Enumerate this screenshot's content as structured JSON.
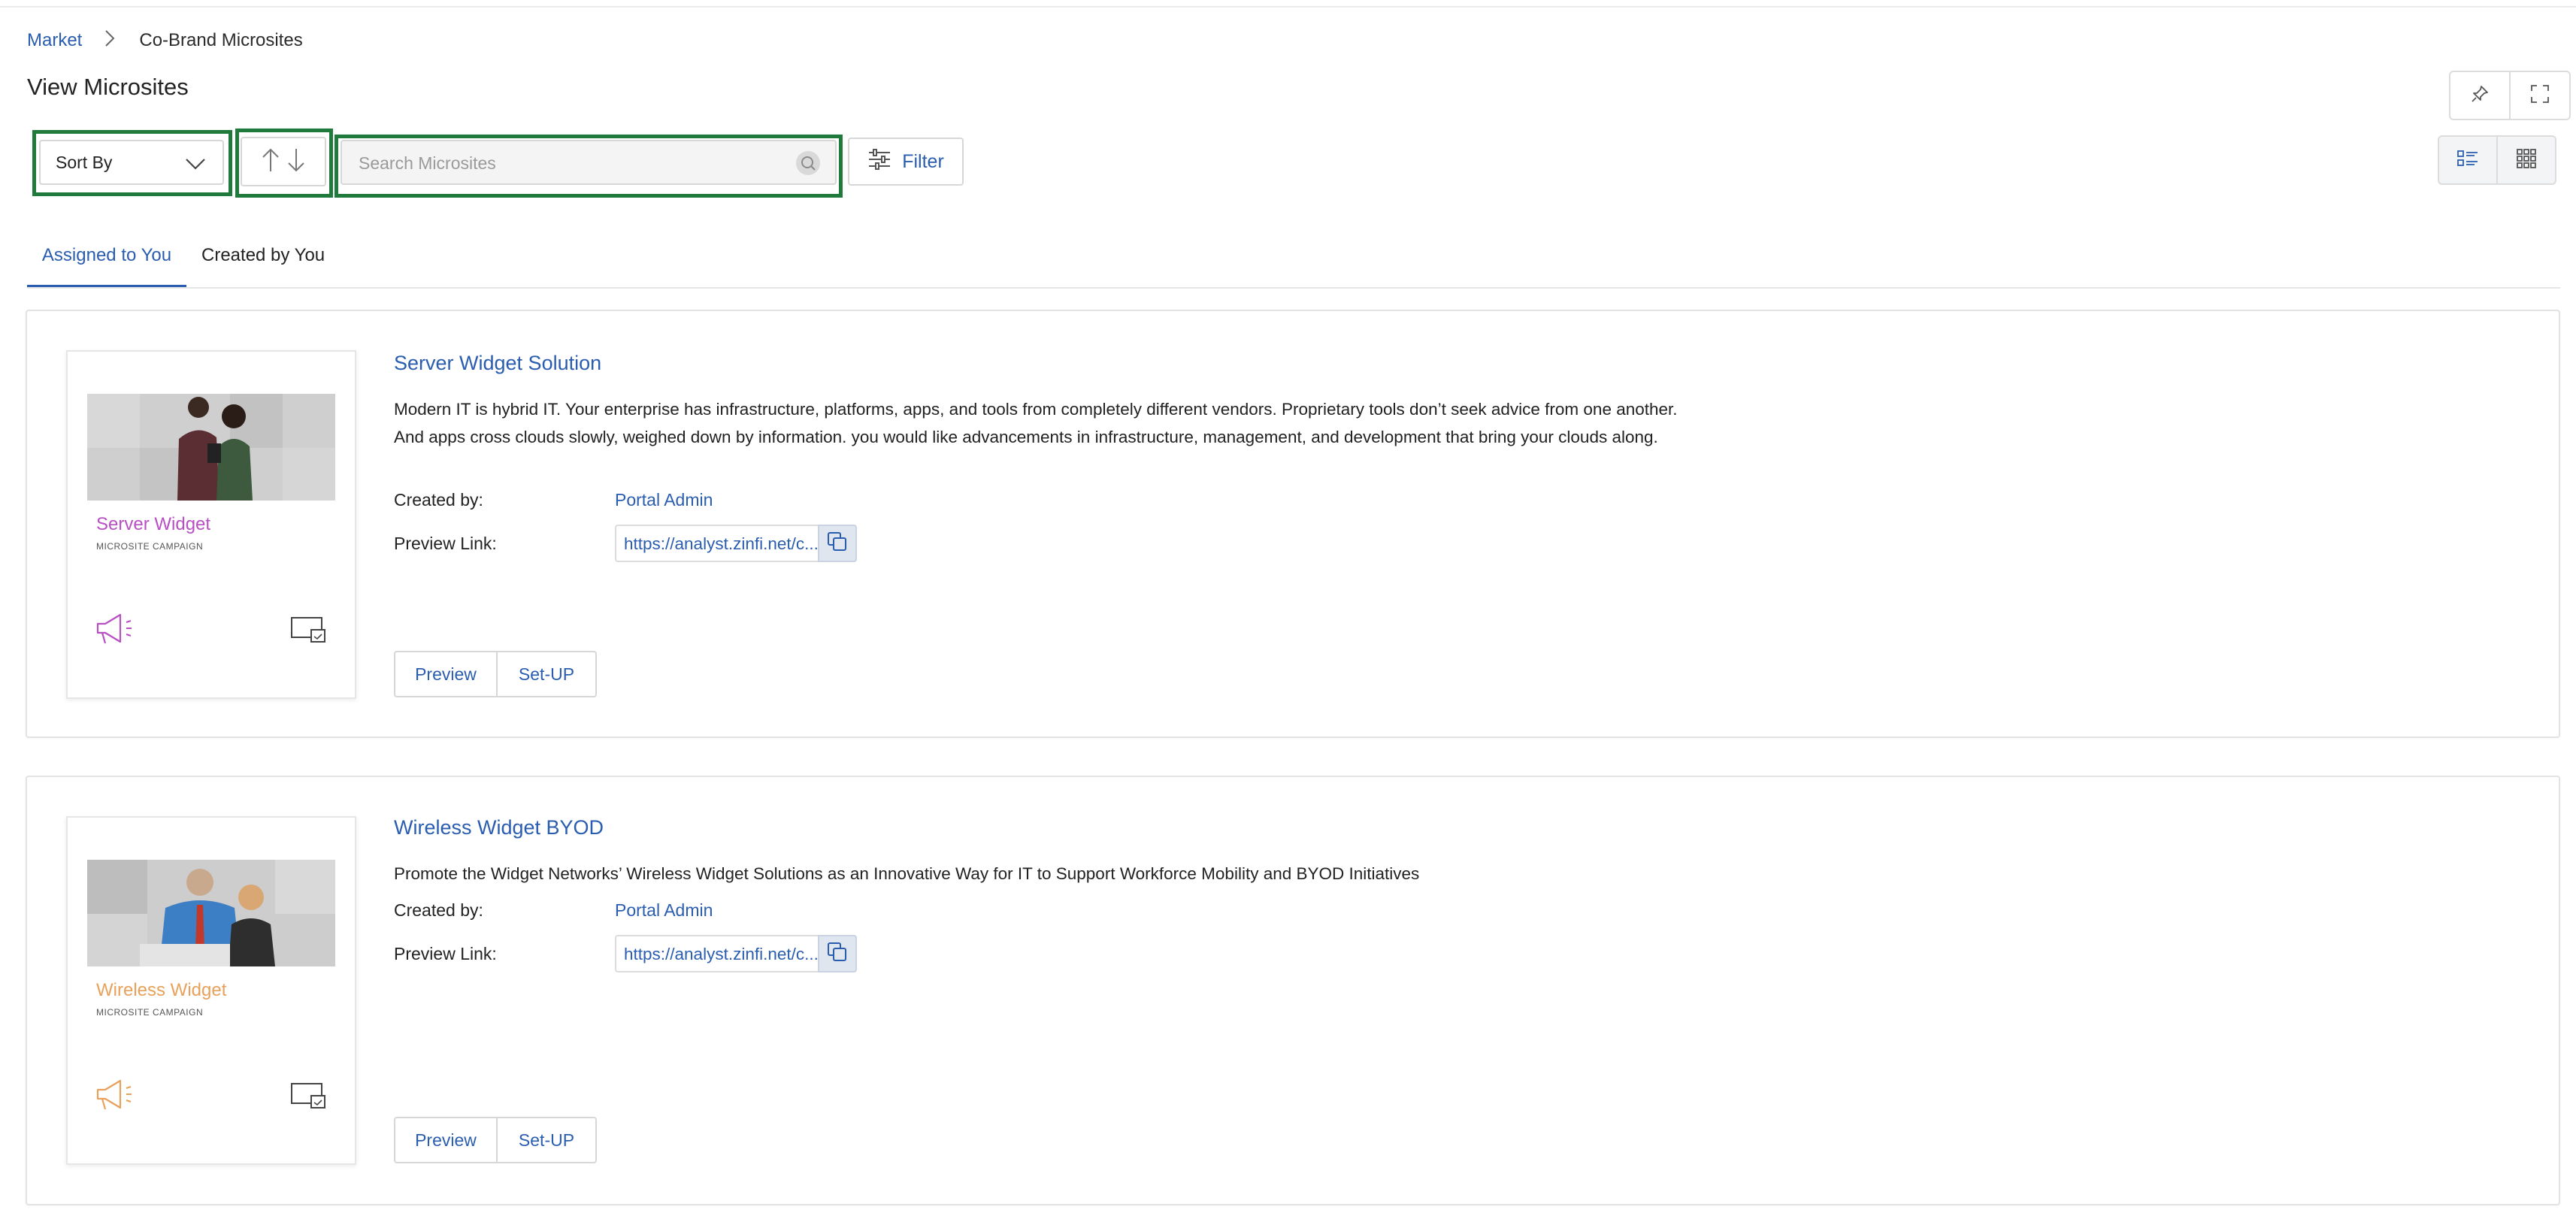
{
  "breadcrumb": {
    "root": "Market",
    "current": "Co-Brand Microsites"
  },
  "page": {
    "title": "View Microsites"
  },
  "toolbar": {
    "sort_label": "Sort By",
    "search_placeholder": "Search Microsites",
    "filter_label": "Filter"
  },
  "tabs": [
    {
      "label": "Assigned to You",
      "active": true
    },
    {
      "label": "Created by You",
      "active": false
    }
  ],
  "labels": {
    "created_by": "Created by:",
    "preview_link": "Preview Link:"
  },
  "microsites": [
    {
      "title": "Server Widget Solution",
      "description": "Modern IT is hybrid IT. Your enterprise has infrastructure, platforms, apps, and tools from completely different vendors. Proprietary tools don’t seek advice from one another. And apps cross clouds slowly, weighed down by information. you would like advancements in infrastructure, management, and development that bring your clouds along.",
      "created_by": "Portal Admin",
      "preview_link": "https://analyst.zinfi.net/c...",
      "thumb_name": "Server Widget",
      "thumb_sub": "MICROSITE CAMPAIGN",
      "accent": "#b84fc4",
      "preview_label": "Preview",
      "setup_label": "Set-UP"
    },
    {
      "title": "Wireless Widget BYOD",
      "description": "Promote the Widget Networks’ Wireless Widget Solutions as an Innovative Way for IT to Support Workforce Mobility and BYOD Initiatives",
      "created_by": "Portal Admin",
      "preview_link": "https://analyst.zinfi.net/c...",
      "thumb_name": "Wireless Widget",
      "thumb_sub": "MICROSITE CAMPAIGN",
      "accent": "#e8a15a",
      "preview_label": "Preview",
      "setup_label": "Set-UP"
    }
  ],
  "colors": {
    "link": "#2a5db0",
    "highlight": "#1f7a3c",
    "border": "#d7d7d7"
  },
  "icons": [
    "chevron-right-icon",
    "pin-icon",
    "fullscreen-icon",
    "chevron-down-icon",
    "sort-up-icon",
    "sort-down-icon",
    "search-icon",
    "filter-sliders-icon",
    "list-view-icon",
    "grid-view-icon",
    "copy-icon",
    "megaphone-icon",
    "screen-icon"
  ]
}
